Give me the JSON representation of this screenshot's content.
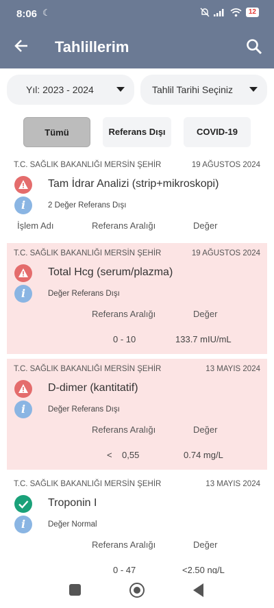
{
  "status_bar": {
    "time": "8:06",
    "battery": "12"
  },
  "header": {
    "title": "Tahlillerim"
  },
  "filters": {
    "year_dropdown": "Yıl: 2023 - 2024",
    "date_dropdown": "Tahlil Tarihi Seçiniz",
    "tabs": [
      "Tümü",
      "Referans Dışı",
      "COVID-19"
    ]
  },
  "colors": {
    "header_bg": "#6b7a94",
    "alert_card_bg": "#fce4e4",
    "warning_icon": "#e46c6c",
    "normal_icon": "#1aa179",
    "info_icon": "#8ab5e3"
  },
  "results": [
    {
      "institution": "T.C. SAĞLIK BAKANLIĞI MERSİN ŞEHİR",
      "date": "19 AĞUSTOS 2024",
      "name": "Tam İdrar Analizi (strip+mikroskopi)",
      "status": "warning-icon",
      "summary": "2 Değer Referans Dışı",
      "headers": {
        "name": "İşlem Adı",
        "range": "Referans Aralığı",
        "value": "Değer"
      }
    },
    {
      "institution": "T.C. SAĞLIK BAKANLIĞI MERSİN ŞEHİR",
      "date": "19 AĞUSTOS 2024",
      "name": "Total Hcg (serum/plazma)",
      "status": "warning-icon",
      "summary": "Değer Referans Dışı",
      "headers": {
        "range": "Referans Aralığı",
        "value": "Değer"
      },
      "range": "0 - 10",
      "value": "133.7 mIU/mL"
    },
    {
      "institution": "T.C. SAĞLIK BAKANLIĞI MERSİN ŞEHİR",
      "date": "13 MAYIS 2024",
      "name": "D-dimer (kantitatif)",
      "status": "warning-icon",
      "summary": "Değer Referans Dışı",
      "headers": {
        "range": "Referans Aralığı",
        "value": "Değer"
      },
      "range": "<    0,55",
      "value": "0.74 mg/L"
    },
    {
      "institution": "T.C. SAĞLIK BAKANLIĞI MERSİN ŞEHİR",
      "date": "13 MAYIS 2024",
      "name": "Troponin I",
      "status": "check-icon",
      "summary": "Değer Normal",
      "headers": {
        "range": "Referans Aralığı",
        "value": "Değer"
      },
      "range": "0 - 47",
      "value": "<2.50 ng/L"
    }
  ]
}
